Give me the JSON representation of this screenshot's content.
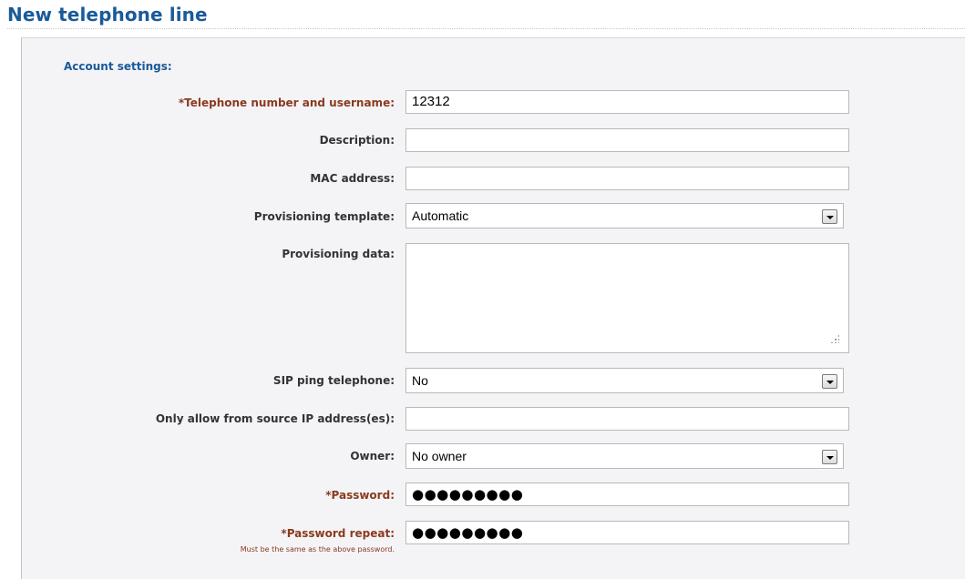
{
  "page": {
    "title": "New telephone line"
  },
  "account_settings": {
    "section_title": "Account settings:",
    "telephone_number": {
      "label": "*Telephone number and username:",
      "value": "12312"
    },
    "description": {
      "label": "Description:",
      "value": ""
    },
    "mac_address": {
      "label": "MAC address:",
      "value": ""
    },
    "provisioning_template": {
      "label": "Provisioning template:",
      "selected": "Automatic"
    },
    "provisioning_data": {
      "label": "Provisioning data:",
      "value": ""
    },
    "sip_ping_telephone": {
      "label": "SIP ping telephone:",
      "selected": "No"
    },
    "source_ip": {
      "label": "Only allow from source IP address(es):",
      "value": ""
    },
    "owner": {
      "label": "Owner:",
      "selected": "No owner"
    },
    "password": {
      "label": "*Password:",
      "masked_value": "●●●●●●●●●"
    },
    "password_repeat": {
      "label": "*Password repeat:",
      "masked_value": "●●●●●●●●●",
      "hint": "Must be the same as the above password."
    }
  },
  "colors": {
    "title": "#1a5a99",
    "required_label": "#8b3a1e",
    "label": "#333333",
    "panel_background": "#f4f4f7"
  }
}
